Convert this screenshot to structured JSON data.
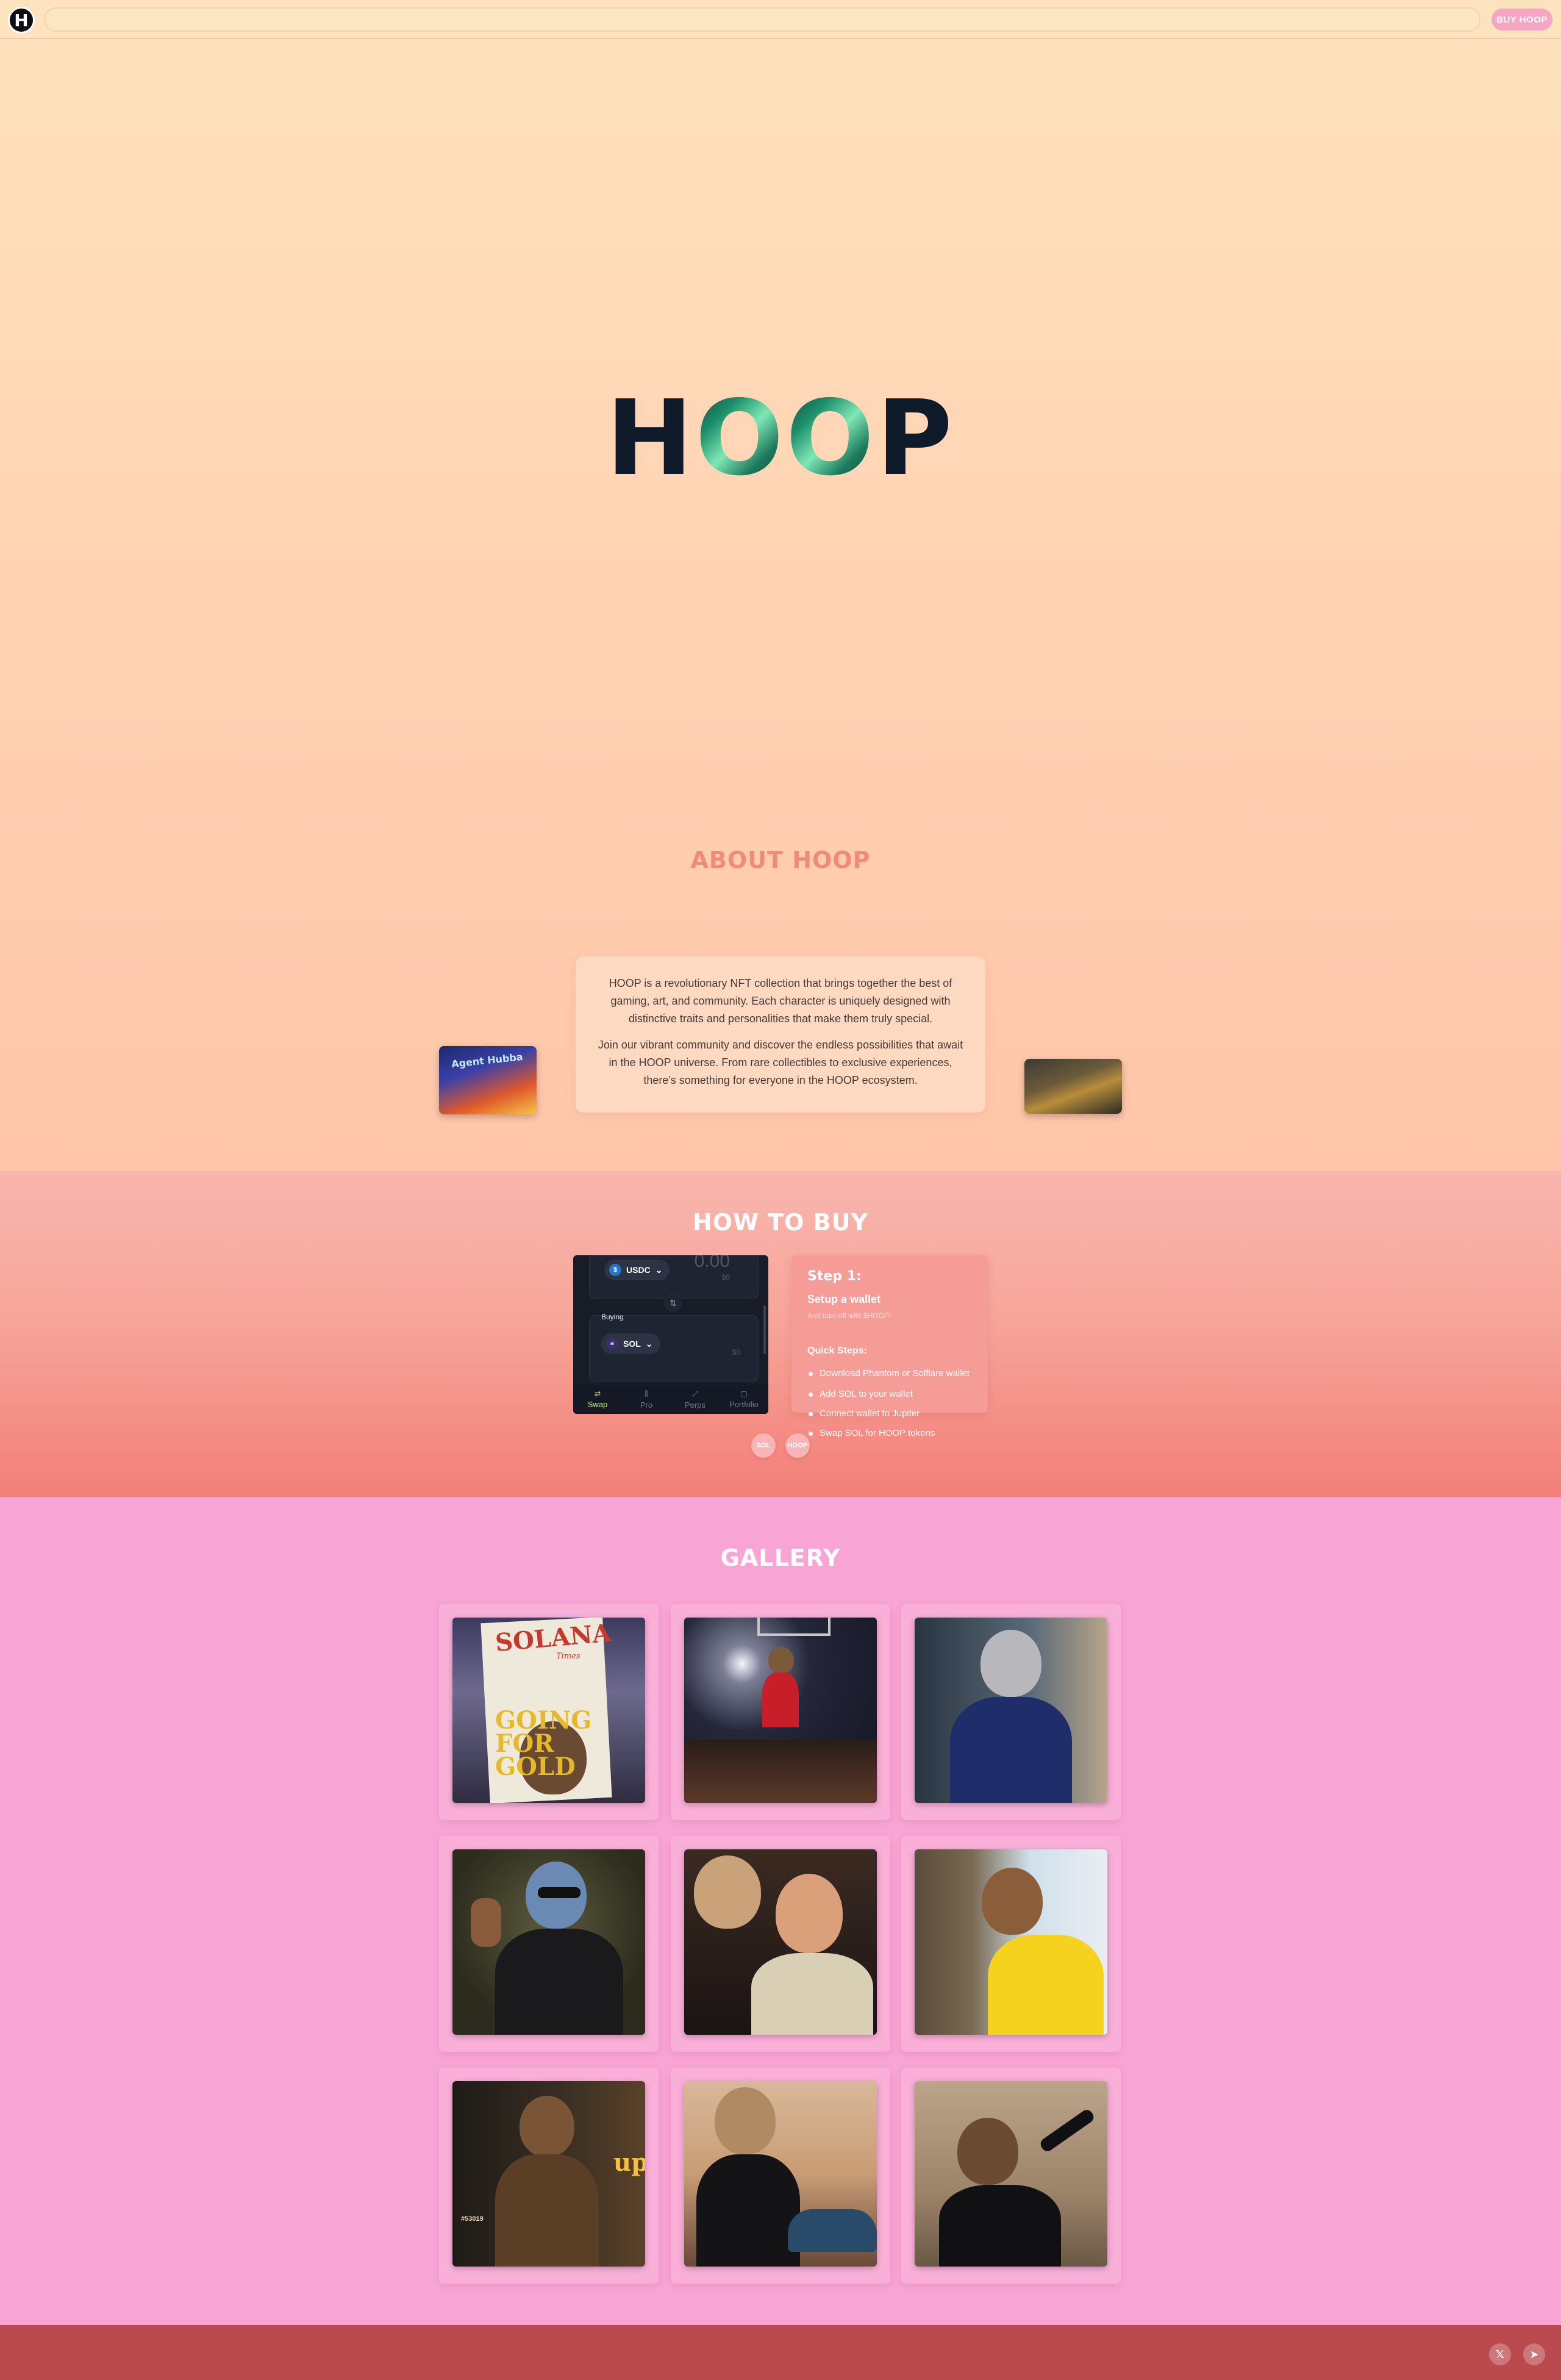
{
  "nav": {
    "logo_letter": "H",
    "search_value": "",
    "buy_label": "BUY HOOP"
  },
  "hero": {
    "title_letters": [
      "H",
      "O",
      "O",
      "P"
    ]
  },
  "about": {
    "title": "ABOUT HOOP",
    "paragraph1": "HOOP is a revolutionary NFT collection that brings together the best of gaming, art, and community. Each character is uniquely designed with distinctive traits and personalities that make them truly special.",
    "paragraph2": "Join our vibrant community and discover the endless possibilities that await in the HOOP universe. From rare collectibles to exclusive experiences, there's something for everyone in the HOOP ecosystem.",
    "left_image_sign": "Agent Hubba"
  },
  "howto": {
    "title": "HOW TO BUY",
    "swap": {
      "sell_token": "USDC",
      "sell_amount": "0.00",
      "sell_usd": "$0",
      "buying_label": "Buying",
      "buy_token": "SOL",
      "buy_usd": "$0",
      "tabs": [
        {
          "icon": "⇄",
          "label": "Swap"
        },
        {
          "icon": "⫼",
          "label": "Pro"
        },
        {
          "icon": "⤢",
          "label": "Perps"
        },
        {
          "icon": "▢",
          "label": "Portfolio"
        }
      ]
    },
    "step": {
      "number": "Step 1:",
      "heading": "Setup a wallet",
      "subheading": "And take off with $HOOP!",
      "quick_steps_label": "Quick Steps:",
      "items": [
        "Download Phantom or Solflare wallet",
        "Add SOL to your wallet",
        "Connect wallet to Jupiter",
        "Swap SOL for HOOP tokens"
      ]
    },
    "coins": [
      "SOL",
      "HOOP"
    ]
  },
  "gallery": {
    "title": "GALLERY",
    "newspaper_masthead": "SOLANA",
    "newspaper_sub": "Times",
    "newspaper_headline1": "GOING",
    "newspaper_headline2": "FOR",
    "newspaper_headline3": "GOLD",
    "courier_logo": "ups",
    "courier_id": "#53019"
  },
  "footer": {
    "x_icon": "𝕏",
    "telegram_icon": "➤"
  }
}
